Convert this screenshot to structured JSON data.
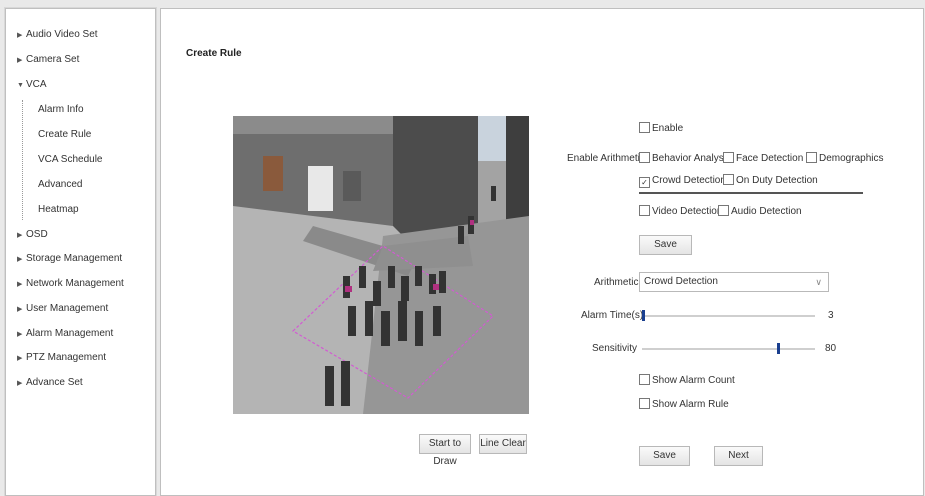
{
  "sidebar": {
    "items": [
      {
        "label": "Audio Video Set"
      },
      {
        "label": "Camera Set"
      },
      {
        "label": "VCA"
      },
      {
        "label": "OSD"
      },
      {
        "label": "Storage Management"
      },
      {
        "label": "Network Management"
      },
      {
        "label": "User Management"
      },
      {
        "label": "Alarm Management"
      },
      {
        "label": "PTZ Management"
      },
      {
        "label": "Advance Set"
      }
    ],
    "vca_children": [
      {
        "label": "Alarm Info"
      },
      {
        "label": "Create Rule"
      },
      {
        "label": "VCA Schedule"
      },
      {
        "label": "Advanced"
      },
      {
        "label": "Heatmap"
      }
    ]
  },
  "main": {
    "title": "Create Rule",
    "start_draw_label": "Start to Draw",
    "line_clear_label": "Line Clear",
    "enable_label": "Enable",
    "enable_checked": false,
    "enable_arithmetic_label": "Enable Arithmetic",
    "arithmetic_options": [
      {
        "label": "Behavior Analysis",
        "checked": false
      },
      {
        "label": "Face Detection",
        "checked": false
      },
      {
        "label": "Demographics",
        "checked": false
      },
      {
        "label": "Crowd Detection",
        "checked": true
      },
      {
        "label": "On Duty Detection",
        "checked": false
      },
      {
        "label": "Video Detection",
        "checked": false
      },
      {
        "label": "Audio Detection",
        "checked": false
      }
    ],
    "save_top_label": "Save",
    "arithmetic_label": "Arithmetic",
    "arithmetic_value": "Crowd Detection",
    "alarm_time_label": "Alarm Time(s)",
    "alarm_time_value": "3",
    "sensitivity_label": "Sensitivity",
    "sensitivity_value": "80",
    "show_alarm_count_label": "Show Alarm Count",
    "show_alarm_count_checked": false,
    "show_alarm_rule_label": "Show Alarm Rule",
    "show_alarm_rule_checked": false,
    "save_bottom_label": "Save",
    "next_label": "Next"
  },
  "colors": {
    "slider_thumb": "#1a3f8f",
    "rule_outline": "#d25bd2"
  },
  "icons": {
    "collapsed": "triangle-right-icon",
    "expanded": "triangle-down-icon",
    "dropdown": "chevron-down-icon"
  }
}
